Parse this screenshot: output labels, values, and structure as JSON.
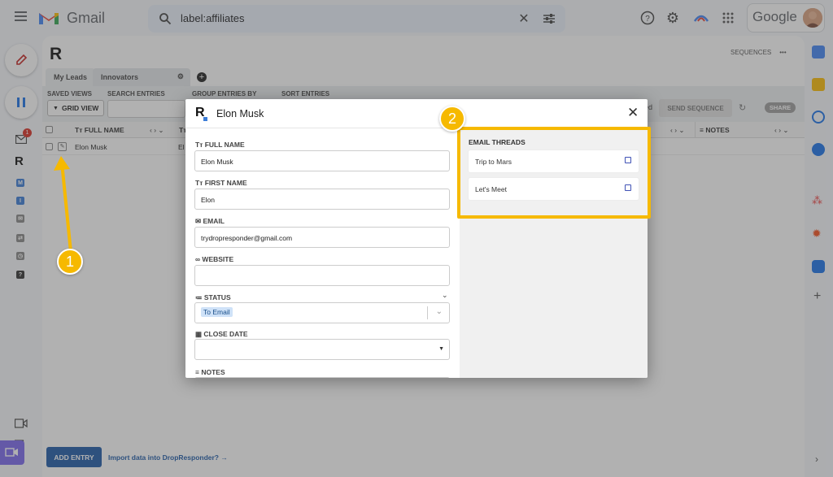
{
  "gmail": {
    "app_name": "Gmail",
    "search_query": "label:affiliates",
    "google_label": "Google",
    "notification_count": "1"
  },
  "dropresponder": {
    "tabs": [
      {
        "label": "My Leads"
      },
      {
        "label": "Innovators"
      }
    ],
    "sequences_label": "SEQUENCES",
    "toolbar": {
      "saved_views": "SAVED VIEWS",
      "grid_view": "GRID VIEW",
      "search_entries": "SEARCH ENTRIES",
      "group_entries_by": "GROUP ENTRIES BY",
      "sort_entries": "SORT ENTRIES",
      "send_sequence": "SEND SEQUENCE",
      "share": "SHARE",
      "partial_text": "ed"
    },
    "columns": {
      "full_name": "FULL NAME",
      "notes": "NOTES",
      "sort_glyph": "‹ › ⌄"
    },
    "rows": [
      {
        "full_name": "Elon Musk",
        "first_name_partial": "El"
      }
    ],
    "add_entry": "ADD ENTRY",
    "import_link": "Import data into DropResponder? →"
  },
  "modal": {
    "title": "Elon Musk",
    "fields": {
      "full_name": {
        "label": "FULL NAME",
        "value": "Elon Musk"
      },
      "first_name": {
        "label": "FIRST NAME",
        "value": "Elon"
      },
      "email": {
        "label": "EMAIL",
        "value": "trydropresponder@gmail.com"
      },
      "website": {
        "label": "WEBSITE",
        "value": ""
      },
      "status": {
        "label": "STATUS",
        "value": "To Email"
      },
      "close_date": {
        "label": "CLOSE DATE",
        "value": ""
      },
      "notes": {
        "label": "NOTES"
      }
    },
    "email_threads": {
      "heading": "EMAIL THREADS",
      "items": [
        {
          "label": "Trip to Mars"
        },
        {
          "label": "Let's Meet"
        }
      ]
    }
  },
  "annotations": {
    "badge1": "1",
    "badge2": "2",
    "color": "#f6b900"
  }
}
